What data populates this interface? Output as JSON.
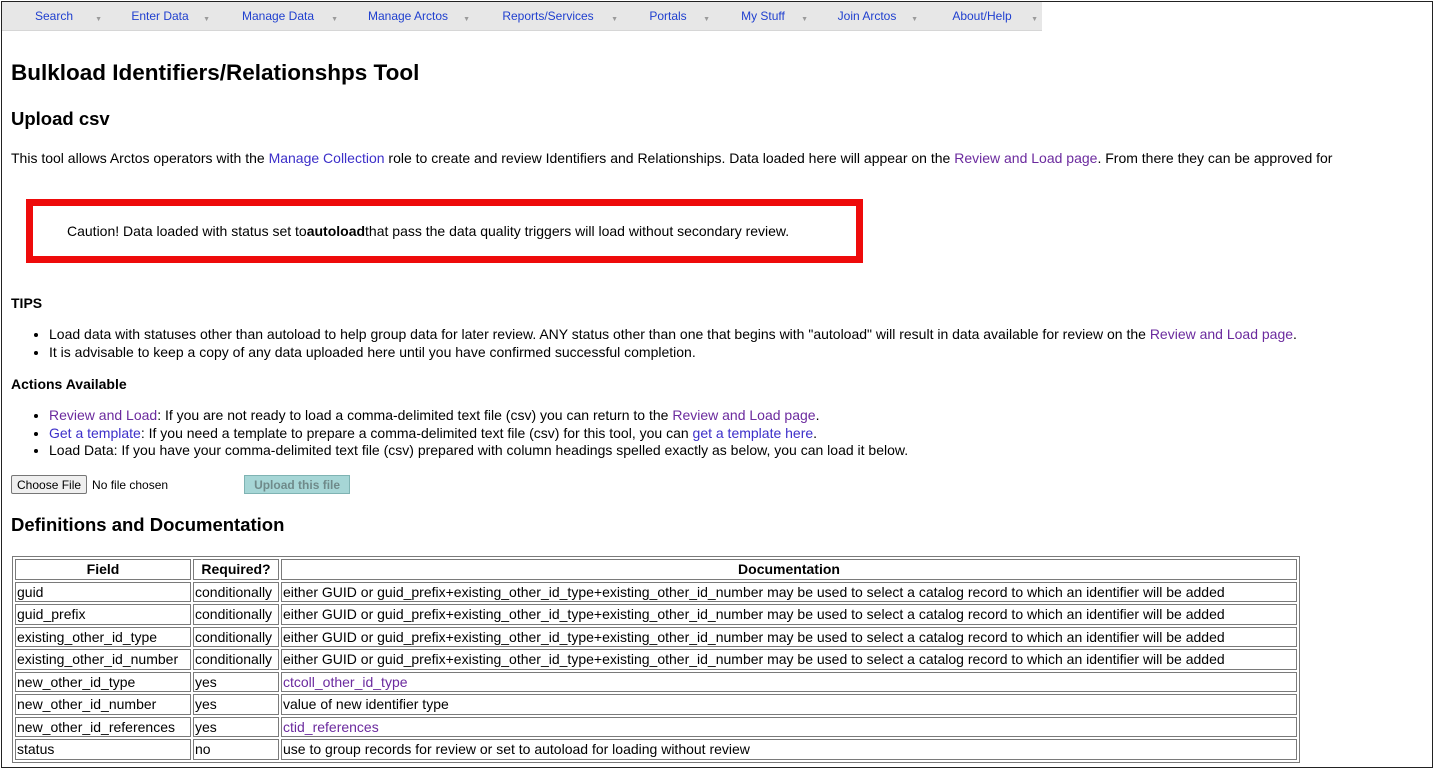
{
  "nav": {
    "items": [
      "Search",
      "Enter Data",
      "Manage Data",
      "Manage Arctos",
      "Reports/Services",
      "Portals",
      "My Stuff",
      "Join Arctos",
      "About/Help"
    ]
  },
  "page": {
    "title": "Bulkload Identifiers/Relationshps Tool",
    "subtitle": "Upload csv",
    "intro_pre": "This tool allows Arctos operators with the ",
    "intro_link1": "Manage Collection",
    "intro_mid": " role to create and review Identifiers and Relationships. Data loaded here will appear on the ",
    "intro_link2": "Review and Load page",
    "intro_post": ". From there they can be approved for"
  },
  "caution": {
    "pre": "Caution! Data loaded with status set to ",
    "bold": "autoload",
    "post": " that pass the data quality triggers will load without secondary review."
  },
  "tips": {
    "heading": "TIPS",
    "item1_pre": "Load data with statuses other than autoload to help group data for later review. ANY status other than one that begins with \"autoload\" will result in data available for review on the ",
    "item1_link": "Review and Load page",
    "item1_post": ".",
    "item2": "It is advisable to keep a copy of any data uploaded here until you have confirmed successful completion."
  },
  "actions": {
    "heading": "Actions Available",
    "review_link": "Review and Load",
    "review_text": ": If you are not ready to load a comma-delimited text file (csv) you can return to the ",
    "review_link2": "Review and Load page",
    "review_end": ".",
    "template_link": "Get a template",
    "template_text": ": If you need a template to prepare a comma-delimited text file (csv) for this tool, you can ",
    "template_link2": "get a template here",
    "template_end": ".",
    "load_text": "Load Data: If you have your comma-delimited text file (csv) prepared with column headings spelled exactly as below, you can load it below."
  },
  "upload": {
    "choose_label": "Choose File",
    "no_file": "No file chosen",
    "upload_label": "Upload this file"
  },
  "definitions": {
    "heading": "Definitions and Documentation",
    "columns": [
      "Field",
      "Required?",
      "Documentation"
    ],
    "rows": [
      {
        "field": "guid",
        "required": "conditionally",
        "doc": "either GUID or guid_prefix+existing_other_id_type+existing_other_id_number may be used to select a catalog record to which an identifier will be added",
        "is_link": false
      },
      {
        "field": "guid_prefix",
        "required": "conditionally",
        "doc": "either GUID or guid_prefix+existing_other_id_type+existing_other_id_number may be used to select a catalog record to which an identifier will be added",
        "is_link": false
      },
      {
        "field": "existing_other_id_type",
        "required": "conditionally",
        "doc": "either GUID or guid_prefix+existing_other_id_type+existing_other_id_number may be used to select a catalog record to which an identifier will be added",
        "is_link": false
      },
      {
        "field": "existing_other_id_number",
        "required": "conditionally",
        "doc": "either GUID or guid_prefix+existing_other_id_type+existing_other_id_number may be used to select a catalog record to which an identifier will be added",
        "is_link": false
      },
      {
        "field": "new_other_id_type",
        "required": "yes",
        "doc": "ctcoll_other_id_type",
        "is_link": true
      },
      {
        "field": "new_other_id_number",
        "required": "yes",
        "doc": "value of new identifier type",
        "is_link": false
      },
      {
        "field": "new_other_id_references",
        "required": "yes",
        "doc": "ctid_references",
        "is_link": true
      },
      {
        "field": "status",
        "required": "no",
        "doc": "use to group records for review or set to autoload for loading without review",
        "is_link": false
      }
    ]
  },
  "colors": {
    "link": "#3c2fc9",
    "visited_link": "#6b2a9e",
    "caution_border": "#ee0b0b",
    "nav_bg": "#e7e7e7",
    "nav_text": "#1f3fcf"
  }
}
